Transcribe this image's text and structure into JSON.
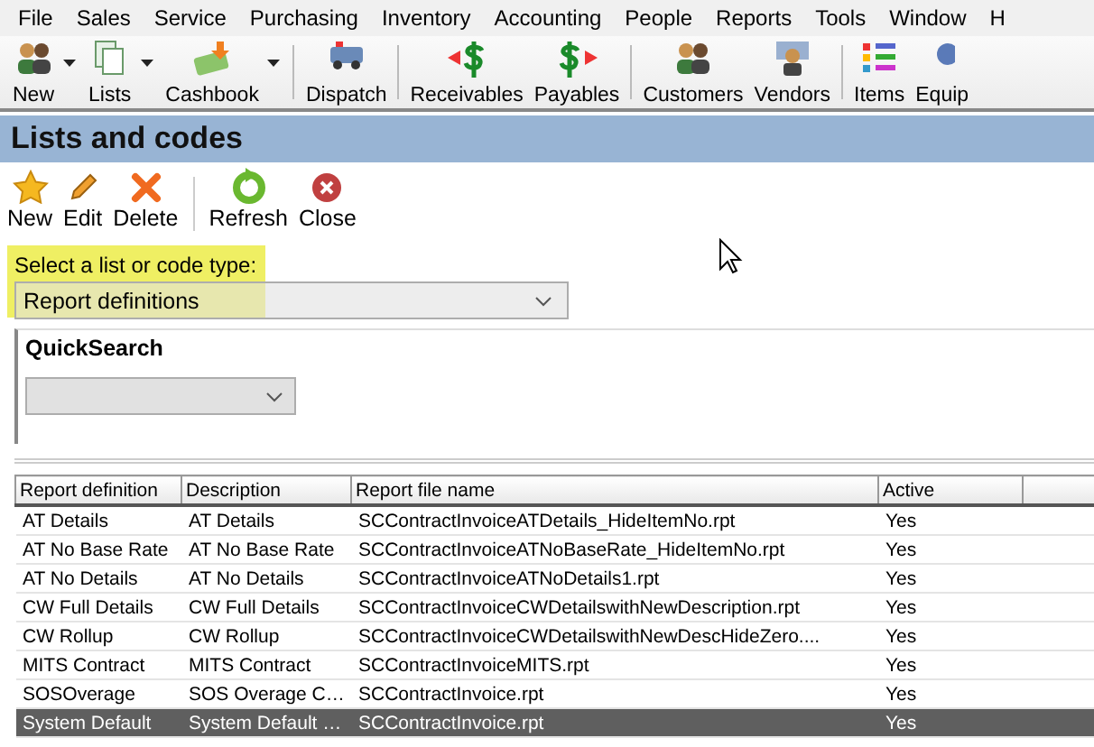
{
  "menu": [
    "File",
    "Sales",
    "Service",
    "Purchasing",
    "Inventory",
    "Accounting",
    "People",
    "Reports",
    "Tools",
    "Window",
    "H"
  ],
  "toolbar": [
    {
      "label": "New",
      "dropdown": true
    },
    {
      "label": "Lists",
      "dropdown": true
    },
    {
      "label": "Cashbook",
      "dropdown": true
    },
    {
      "label": "Dispatch",
      "dropdown": false
    },
    {
      "label": "Receivables",
      "dropdown": false
    },
    {
      "label": "Payables",
      "dropdown": false
    },
    {
      "label": "Customers",
      "dropdown": false
    },
    {
      "label": "Vendors",
      "dropdown": false
    },
    {
      "label": "Items",
      "dropdown": false
    },
    {
      "label": "Equip",
      "dropdown": false
    }
  ],
  "panel_title": "Lists and codes",
  "actions": [
    "New",
    "Edit",
    "Delete",
    "Refresh",
    "Close"
  ],
  "list_type": {
    "label": "Select a list or code type:",
    "value": "Report definitions",
    "highlighted": true
  },
  "quicksearch": {
    "title": "QuickSearch"
  },
  "table": {
    "columns": [
      "Report definition",
      "Description",
      "Report file name",
      "Active"
    ],
    "rows": [
      {
        "cells": [
          "AT Details",
          "AT Details",
          "SCContractInvoiceATDetails_HideItemNo.rpt",
          "Yes"
        ],
        "selected": false
      },
      {
        "cells": [
          "AT No Base Rate",
          "AT No Base Rate",
          "SCContractInvoiceATNoBaseRate_HideItemNo.rpt",
          "Yes"
        ],
        "selected": false
      },
      {
        "cells": [
          "AT No Details",
          "AT No Details",
          "SCContractInvoiceATNoDetails1.rpt",
          "Yes"
        ],
        "selected": false
      },
      {
        "cells": [
          "CW Full Details",
          "CW Full Details",
          "SCContractInvoiceCWDetailswithNewDescription.rpt",
          "Yes"
        ],
        "selected": false
      },
      {
        "cells": [
          "CW Rollup",
          "CW Rollup",
          "SCContractInvoiceCWDetailswithNewDescHideZero....",
          "Yes"
        ],
        "selected": false
      },
      {
        "cells": [
          "MITS Contract",
          "MITS Contract",
          "SCContractInvoiceMITS.rpt",
          "Yes"
        ],
        "selected": false
      },
      {
        "cells": [
          "SOSOverage",
          "SOS Overage C…",
          "SCContractInvoice.rpt",
          "Yes"
        ],
        "selected": false
      },
      {
        "cells": [
          "System Default",
          "System Default …",
          "SCContractInvoice.rpt",
          "Yes"
        ],
        "selected": true
      }
    ]
  }
}
